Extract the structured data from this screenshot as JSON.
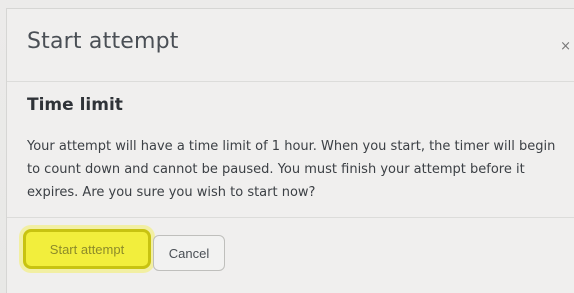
{
  "dialog": {
    "title": "Start attempt",
    "close_label": "×",
    "section_title": "Time limit",
    "message": "Your attempt will have a time limit of 1 hour. When you start, the timer will begin to count down and cannot be paused. You must finish your attempt before it expires. Are you sure you wish to start now?",
    "start_button_label": "Start attempt",
    "cancel_button_label": "Cancel"
  },
  "colors": {
    "highlight": "#f2ee3c",
    "highlight_border": "#c8c311",
    "text": "#3c4045"
  },
  "icons": {
    "close": "close-icon"
  }
}
